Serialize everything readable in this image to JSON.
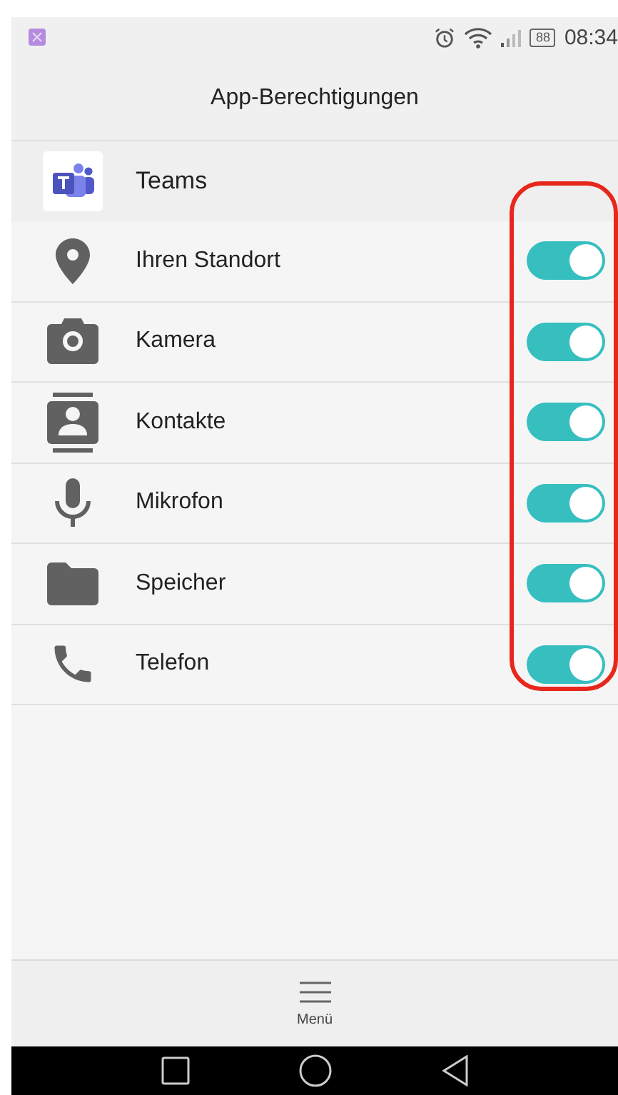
{
  "status_bar": {
    "battery": "88",
    "time": "08:34"
  },
  "header": {
    "title": "App-Berechtigungen"
  },
  "app": {
    "name": "Teams"
  },
  "permissions": [
    {
      "kind": "location",
      "label": "Ihren Standort",
      "on": true
    },
    {
      "kind": "camera",
      "label": "Kamera",
      "on": true
    },
    {
      "kind": "contacts",
      "label": "Kontakte",
      "on": true
    },
    {
      "kind": "microphone",
      "label": "Mikrofon",
      "on": true
    },
    {
      "kind": "storage",
      "label": "Speicher",
      "on": true
    },
    {
      "kind": "phone",
      "label": "Telefon",
      "on": true
    }
  ],
  "bottom_bar": {
    "menu_label": "Menü"
  }
}
